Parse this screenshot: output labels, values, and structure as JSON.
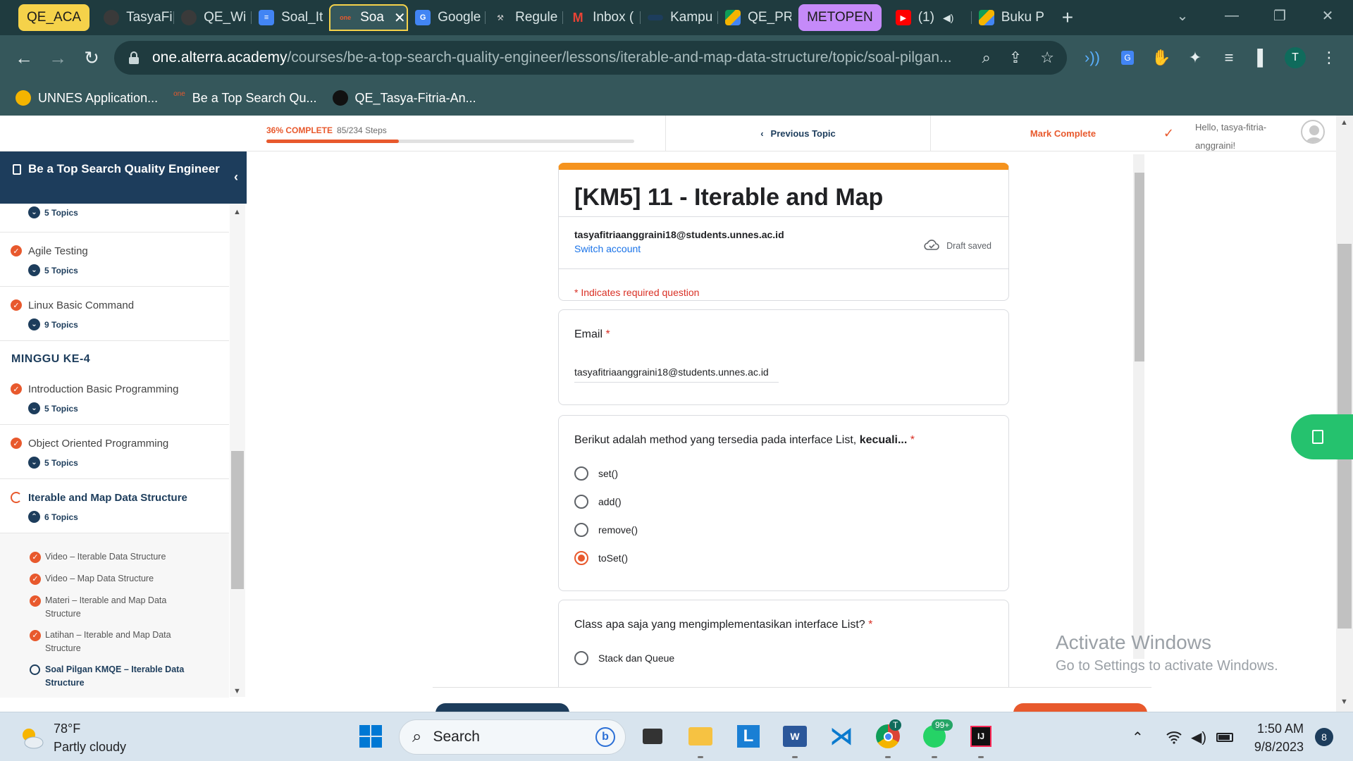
{
  "browser": {
    "tabs": [
      {
        "label": "QE_ACA",
        "style": "group-yellow"
      },
      {
        "label": "TasyaFi",
        "icon": "github-icon"
      },
      {
        "label": "QE_Wi",
        "icon": "github-icon"
      },
      {
        "label": "Soal_It",
        "icon": "docs-icon"
      },
      {
        "label": "Soa",
        "icon": "alterra-icon",
        "active": true
      },
      {
        "label": "Google",
        "icon": "translate-icon"
      },
      {
        "label": "Regule",
        "icon": "tools-icon"
      },
      {
        "label": "Inbox (",
        "icon": "gmail-icon"
      },
      {
        "label": "Kampu",
        "icon": "kampus-icon"
      },
      {
        "label": "QE_PR",
        "icon": "drive-icon"
      },
      {
        "label": "METOPEN",
        "style": "group-purple"
      },
      {
        "label": "(1)",
        "icon": "youtube-icon"
      },
      {
        "label": "Buku P",
        "icon": "drive-icon"
      }
    ],
    "url_host": "one.alterra.academy",
    "url_path": "/courses/be-a-top-search-quality-engineer/lessons/iterable-and-map-data-structure/topic/soal-pilgan...",
    "profile_initial": "T",
    "bookmarks": [
      {
        "label": "UNNES Application..."
      },
      {
        "label": "Be a Top Search Qu..."
      },
      {
        "label": "QE_Tasya-Fitria-An..."
      }
    ]
  },
  "course": {
    "progress_label": "36% COMPLETE",
    "progress_steps": "85/234 Steps",
    "progress_fraction": 0.36,
    "previous_topic": "Previous Topic",
    "mark_complete": "Mark Complete",
    "greeting": "Hello, tasya-fitria-anggraini!"
  },
  "sidebar": {
    "course_title": "Be a Top Search Quality Engineer",
    "first_topics": "5 Topics",
    "lessons": [
      {
        "title": "Agile Testing",
        "topics": "5 Topics"
      },
      {
        "title": "Linux Basic Command",
        "topics": "9 Topics"
      }
    ],
    "section": "MINGGU KE-4",
    "lessons2": [
      {
        "title": "Introduction Basic Programming",
        "topics": "5 Topics"
      },
      {
        "title": "Object Oriented Programming",
        "topics": "5 Topics"
      },
      {
        "title": "Iterable and Map Data Structure",
        "topics": "6 Topics"
      }
    ],
    "subtopics": [
      "Video – Iterable Data Structure",
      "Video – Map Data Structure",
      "Materi – Iterable and Map Data Structure",
      "Latihan – Iterable and Map Data Structure",
      "Soal Pilgan KMQE – Iterable Data Structure"
    ]
  },
  "form": {
    "title": "[KM5] 11 - Iterable and Map",
    "account": "tasyafitriaanggraini18@students.unnes.ac.id",
    "switch_account": "Switch account",
    "draft_status": "Draft saved",
    "required_note": "* Indicates required question",
    "email_label": "Email",
    "email_value": "tasyafitriaanggraini18@students.unnes.ac.id",
    "q1_text": "Berikut adalah method yang tersedia pada interface List, ",
    "q1_bold": "kecuali...",
    "q1_options": [
      "set()",
      "add()",
      "remove()",
      "toSet()"
    ],
    "q1_selected": "toSet()",
    "q2_text": "Class apa saja yang mengimplementasikan interface List?",
    "q2_options": [
      "Stack dan Queue"
    ],
    "required_mark": "*"
  },
  "watermark": {
    "line1": "Activate Windows",
    "line2": "Go to Settings to activate Windows."
  },
  "taskbar": {
    "weather_temp": "78°F",
    "weather_desc": "Partly cloudy",
    "search_placeholder": "Search",
    "whatsapp_badge": "99+",
    "chrome_badge": "T",
    "time": "1:50 AM",
    "date": "9/8/2023",
    "notifications": "8"
  }
}
